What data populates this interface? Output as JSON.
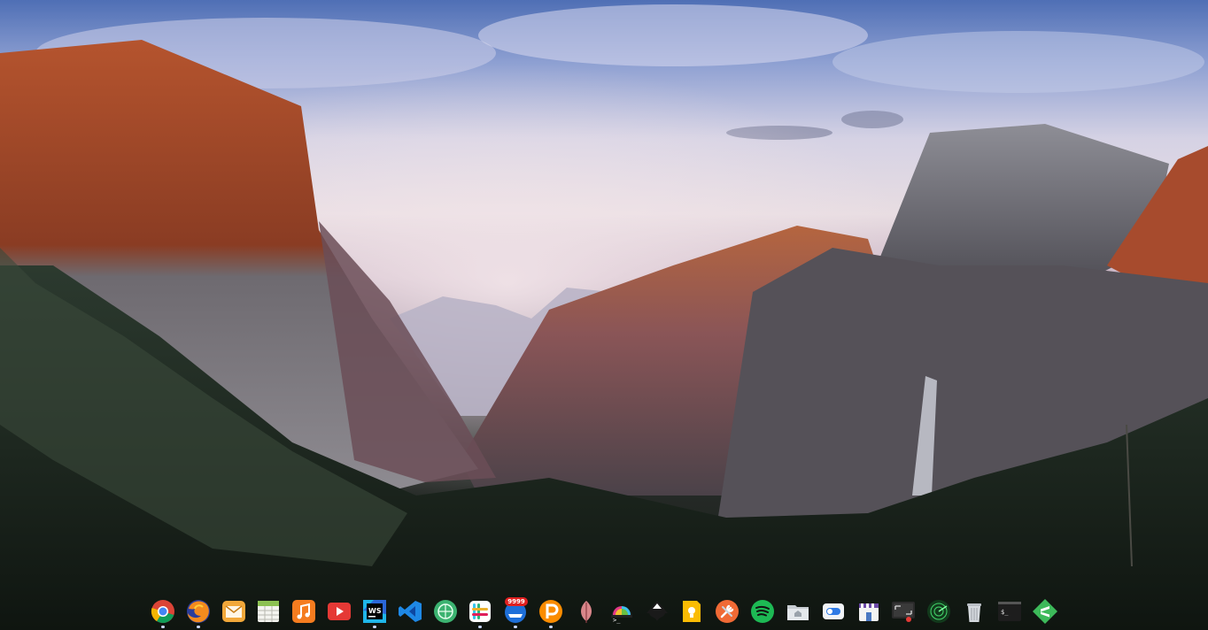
{
  "dock": {
    "items": [
      {
        "name": "chrome-icon",
        "running": true
      },
      {
        "name": "firefox-icon",
        "running": true
      },
      {
        "name": "mail-icon",
        "running": false
      },
      {
        "name": "spreadsheet-icon",
        "running": false
      },
      {
        "name": "music-icon",
        "running": false
      },
      {
        "name": "video-player-icon",
        "running": false
      },
      {
        "name": "webstorm-icon",
        "running": true
      },
      {
        "name": "vscode-icon",
        "running": false
      },
      {
        "name": "git-client-icon",
        "running": false
      },
      {
        "name": "slack-icon",
        "running": true
      },
      {
        "name": "notifications-icon",
        "running": true,
        "badge": "9999"
      },
      {
        "name": "p-app-icon",
        "running": true
      },
      {
        "name": "leaf-icon",
        "running": false
      },
      {
        "name": "hyper-terminal-icon",
        "running": false
      },
      {
        "name": "inkscape-icon",
        "running": false
      },
      {
        "name": "keep-notes-icon",
        "running": false
      },
      {
        "name": "tools-icon",
        "running": false
      },
      {
        "name": "spotify-icon",
        "running": false
      },
      {
        "name": "home-folder-icon",
        "running": false
      },
      {
        "name": "toggle-settings-icon",
        "running": false
      },
      {
        "name": "app-store-icon",
        "running": false
      },
      {
        "name": "screen-recorder-icon",
        "running": false
      },
      {
        "name": "radar-icon",
        "running": false
      },
      {
        "name": "trash-icon",
        "running": false
      },
      {
        "name": "terminal-icon",
        "running": false
      },
      {
        "name": "sublime-icon",
        "running": false
      }
    ]
  }
}
